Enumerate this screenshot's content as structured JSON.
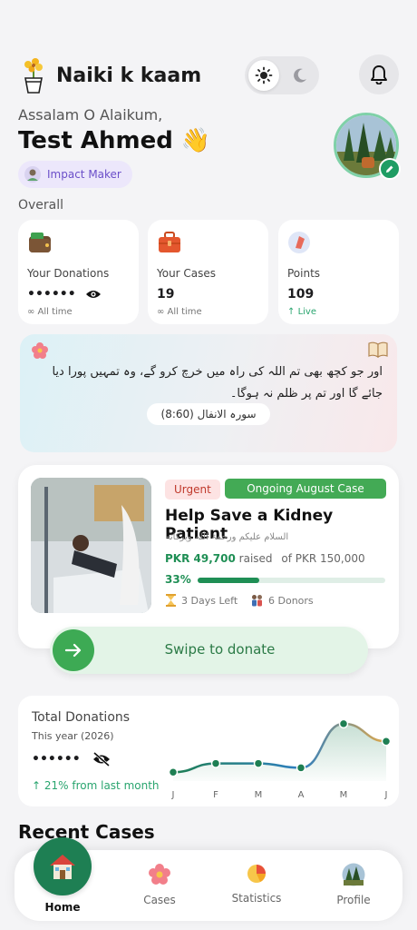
{
  "header": {
    "app_title": "Naiki k kaam",
    "theme_options": [
      "sun-icon",
      "moon-icon"
    ],
    "active_theme": "light"
  },
  "greeting": {
    "salutation": "Assalam O Alaikum,",
    "user_name": "Test Ahmed",
    "wave_emoji": "👋",
    "badge": "Impact Maker"
  },
  "overall": {
    "label": "Overall",
    "cards": [
      {
        "title": "Your Donations",
        "value": "••••••",
        "sub": "All time"
      },
      {
        "title": "Your Cases",
        "value": "19",
        "sub": "All time"
      },
      {
        "title": "Points",
        "value": "109",
        "sub": "Live"
      }
    ]
  },
  "verse": {
    "text": "اور جو کچھ بھی تم اللہ کی راہ میں خرچ کرو گے، وہ تمہیں پورا دیا جائے گا اور تم پر ظلم نہ ہوگا۔",
    "reference": "سورہ الانفال (8:60)"
  },
  "case": {
    "tag_urgent": "Urgent",
    "tag_status": "Ongoing August Case",
    "title": "Help Save a Kidney Patient",
    "subtitle": "السلام علیکم ورحمۃ اللہ وبرکاتہ",
    "raised_amount": "PKR 49,700",
    "raised_word": "raised",
    "goal": "of PKR 150,000",
    "percent_label": "33%",
    "progress": 0.33,
    "days_left": "3 Days Left",
    "donors": "6 Donors"
  },
  "swipe": {
    "label": "Swipe to donate"
  },
  "total_donations": {
    "title": "Total Donations",
    "year": "This year (2026)",
    "hidden_value": "••••••",
    "change": "21% from last month"
  },
  "chart_data": {
    "type": "line",
    "categories": [
      "J",
      "F",
      "M",
      "A",
      "M",
      "J"
    ],
    "values": [
      1,
      2,
      2,
      1.5,
      6.5,
      4.5
    ],
    "ylim": [
      0,
      7
    ],
    "grid": false,
    "series_colors": [
      "#1e7f53",
      "#e0a84a"
    ]
  },
  "behind": {
    "text": "Recent Cases"
  },
  "nav": {
    "items": [
      {
        "label": "Home"
      },
      {
        "label": "Cases"
      },
      {
        "label": "Statistics"
      },
      {
        "label": "Profile"
      }
    ]
  }
}
